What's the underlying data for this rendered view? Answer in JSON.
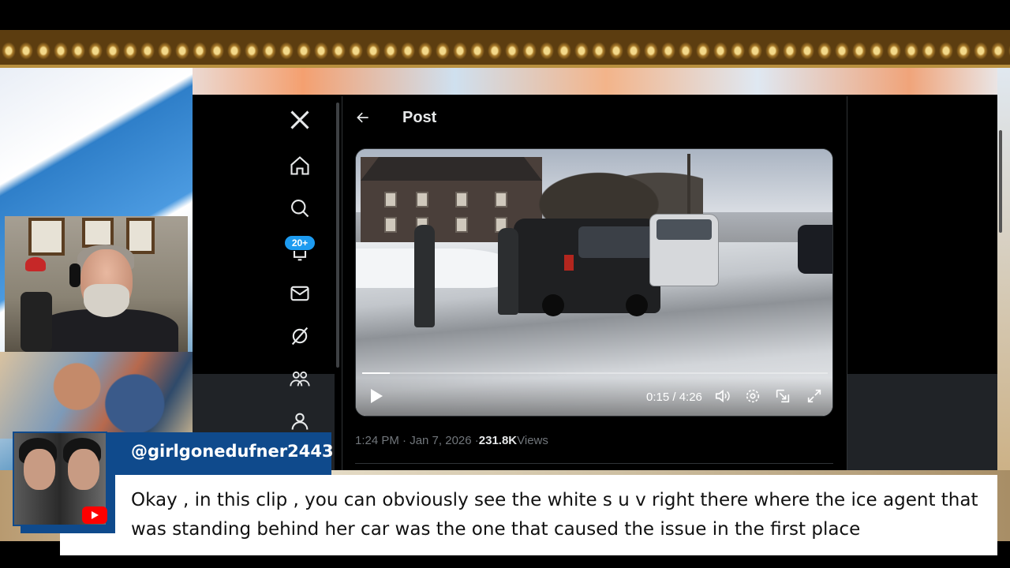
{
  "x_app": {
    "nav": [
      {
        "name": "x-logo-icon",
        "label": "X"
      },
      {
        "name": "home-icon"
      },
      {
        "name": "search-icon"
      },
      {
        "name": "notifications-icon",
        "badge": "20+"
      },
      {
        "name": "messages-icon"
      },
      {
        "name": "grok-icon"
      },
      {
        "name": "communities-icon"
      },
      {
        "name": "profile-icon"
      }
    ],
    "post_header": {
      "title": "Post"
    },
    "video": {
      "time": "0:15 / 4:26",
      "progress": 0.06
    },
    "meta": {
      "time_date": "1:24 PM · Jan 7, 2026 · ",
      "views_count": "231.8K",
      "views_label": " Views"
    }
  },
  "chat": {
    "username": "@girlgonedufner2443",
    "message": "Okay , in this clip , you can obviously see the white s u v right there where the ice agent that was standing behind her car was the one that caused the issue in the first place"
  },
  "colors": {
    "accent": "#1d9bf0",
    "chat_bar": "#0f4a8c",
    "youtube": "#ff0000"
  }
}
